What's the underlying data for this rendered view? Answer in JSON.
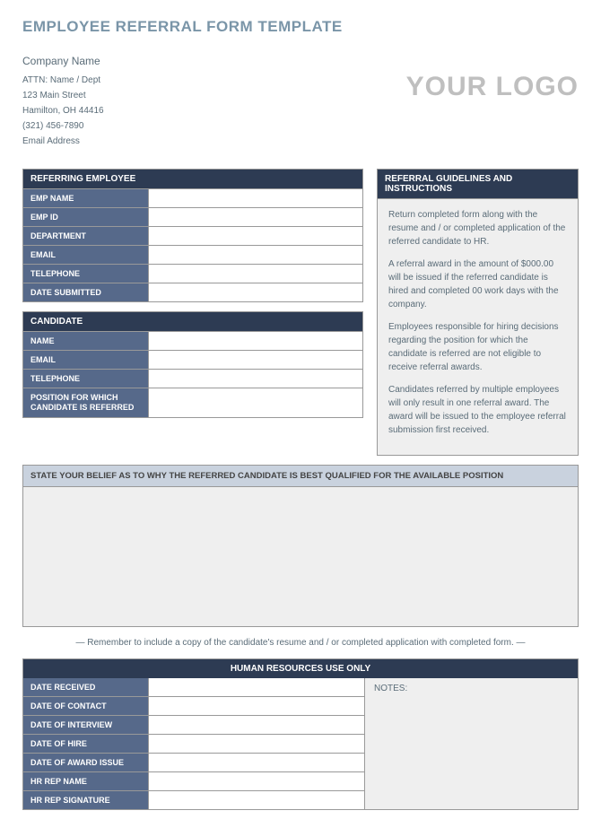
{
  "title": "EMPLOYEE REFERRAL FORM TEMPLATE",
  "company": {
    "name": "Company Name",
    "attn": "ATTN: Name / Dept",
    "street": "123 Main Street",
    "citystate": "Hamilton, OH  44416",
    "phone": "(321) 456-7890",
    "email": "Email Address"
  },
  "logo_text": "YOUR LOGO",
  "referring": {
    "header": "REFERRING EMPLOYEE",
    "fields": {
      "emp_name": "EMP NAME",
      "emp_id": "EMP ID",
      "department": "DEPARTMENT",
      "email": "EMAIL",
      "telephone": "TELEPHONE",
      "date_submitted": "DATE SUBMITTED"
    }
  },
  "candidate": {
    "header": "CANDIDATE",
    "fields": {
      "name": "NAME",
      "email": "EMAIL",
      "telephone": "TELEPHONE",
      "position": "POSITION FOR WHICH CANDIDATE IS REFERRED"
    }
  },
  "guidelines": {
    "header": "REFERRAL GUIDELINES AND INSTRUCTIONS",
    "p1": "Return completed form along with the resume and / or completed application of the referred candidate to HR.",
    "p2": "A referral award in the amount of $000.00 will be issued if the referred candidate is hired and completed 00 work days with the company.",
    "p3": "Employees responsible for hiring decisions regarding the position for which the candidate is referred are not eligible to receive referral awards.",
    "p4": "Candidates referred by multiple employees will only result in one referral award.  The award will be issued to the employee referral submission first received."
  },
  "belief": {
    "header": "STATE YOUR BELIEF AS TO WHY THE REFERRED CANDIDATE IS BEST QUALIFIED FOR THE AVAILABLE POSITION"
  },
  "reminder": "— Remember to include a copy of the candidate's resume and / or completed application with completed form. —",
  "hr": {
    "header": "HUMAN RESOURCES USE ONLY",
    "fields": {
      "date_received": "DATE RECEIVED",
      "date_contact": "DATE OF CONTACT",
      "date_interview": "DATE OF INTERVIEW",
      "date_hire": "DATE OF HIRE",
      "date_award": "DATE OF AWARD ISSUE",
      "rep_name": "HR REP NAME",
      "rep_sig": "HR REP SIGNATURE"
    },
    "notes_label": "NOTES:"
  }
}
